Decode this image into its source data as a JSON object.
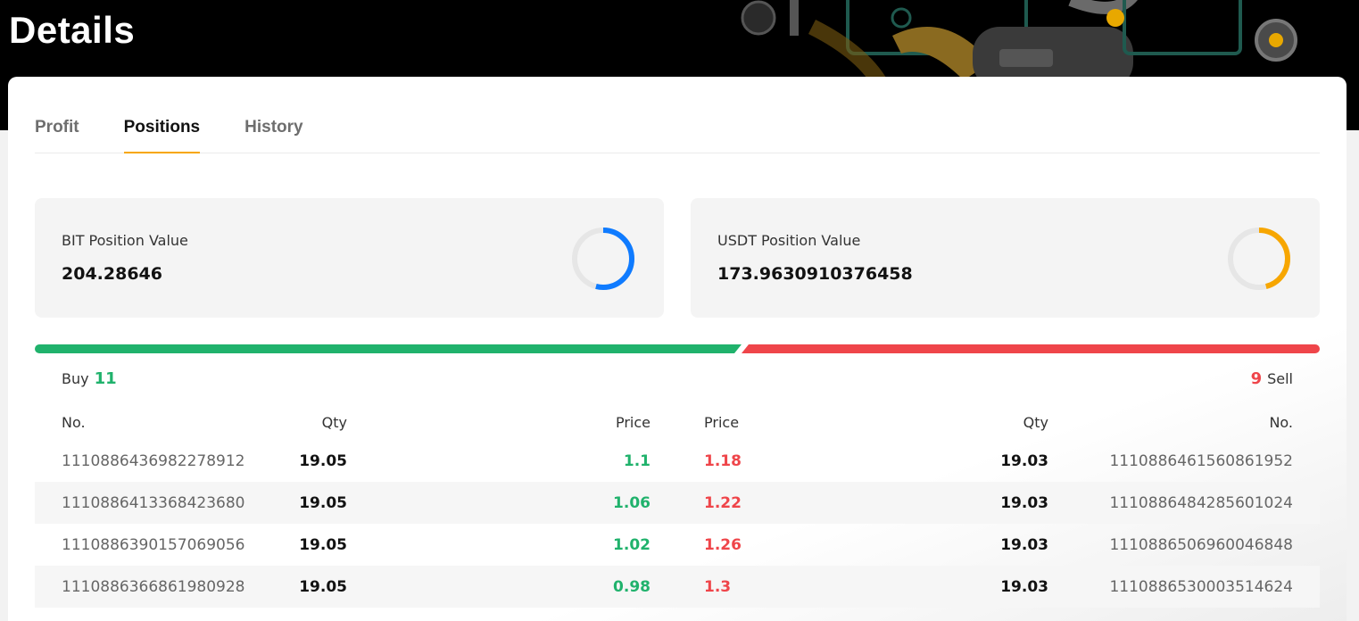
{
  "header": {
    "title": "Details"
  },
  "tabs": [
    {
      "label": "Profit"
    },
    {
      "label": "Positions",
      "active": true
    },
    {
      "label": "History"
    }
  ],
  "stats": {
    "bit": {
      "label": "BIT Position Value",
      "value": "204.28646",
      "ring_color": "#0f7bff",
      "ring_fraction": 0.54
    },
    "usdt": {
      "label": "USDT Position Value",
      "value": "173.9630910376458",
      "ring_color": "#f7a600",
      "ring_fraction": 0.46
    }
  },
  "ratio": {
    "buy_label": "Buy",
    "buy_count": "11",
    "sell_label": "Sell",
    "sell_count": "9",
    "buy_color": "#20b26c",
    "sell_color": "#ef454a"
  },
  "table": {
    "headers": {
      "no_left": "No.",
      "qty_left": "Qty",
      "price_left": "Price",
      "price_right": "Price",
      "qty_right": "Qty",
      "no_right": "No."
    },
    "rows": [
      {
        "buy_no": "1110886436982278912",
        "buy_qty": "19.05",
        "buy_price": "1.1",
        "sell_price": "1.18",
        "sell_qty": "19.03",
        "sell_no": "1110886461560861952"
      },
      {
        "buy_no": "1110886413368423680",
        "buy_qty": "19.05",
        "buy_price": "1.06",
        "sell_price": "1.22",
        "sell_qty": "19.03",
        "sell_no": "1110886484285601024"
      },
      {
        "buy_no": "1110886390157069056",
        "buy_qty": "19.05",
        "buy_price": "1.02",
        "sell_price": "1.26",
        "sell_qty": "19.03",
        "sell_no": "1110886506960046848"
      },
      {
        "buy_no": "1110886366861980928",
        "buy_qty": "19.05",
        "buy_price": "0.98",
        "sell_price": "1.3",
        "sell_qty": "19.03",
        "sell_no": "1110886530003514624"
      }
    ]
  }
}
